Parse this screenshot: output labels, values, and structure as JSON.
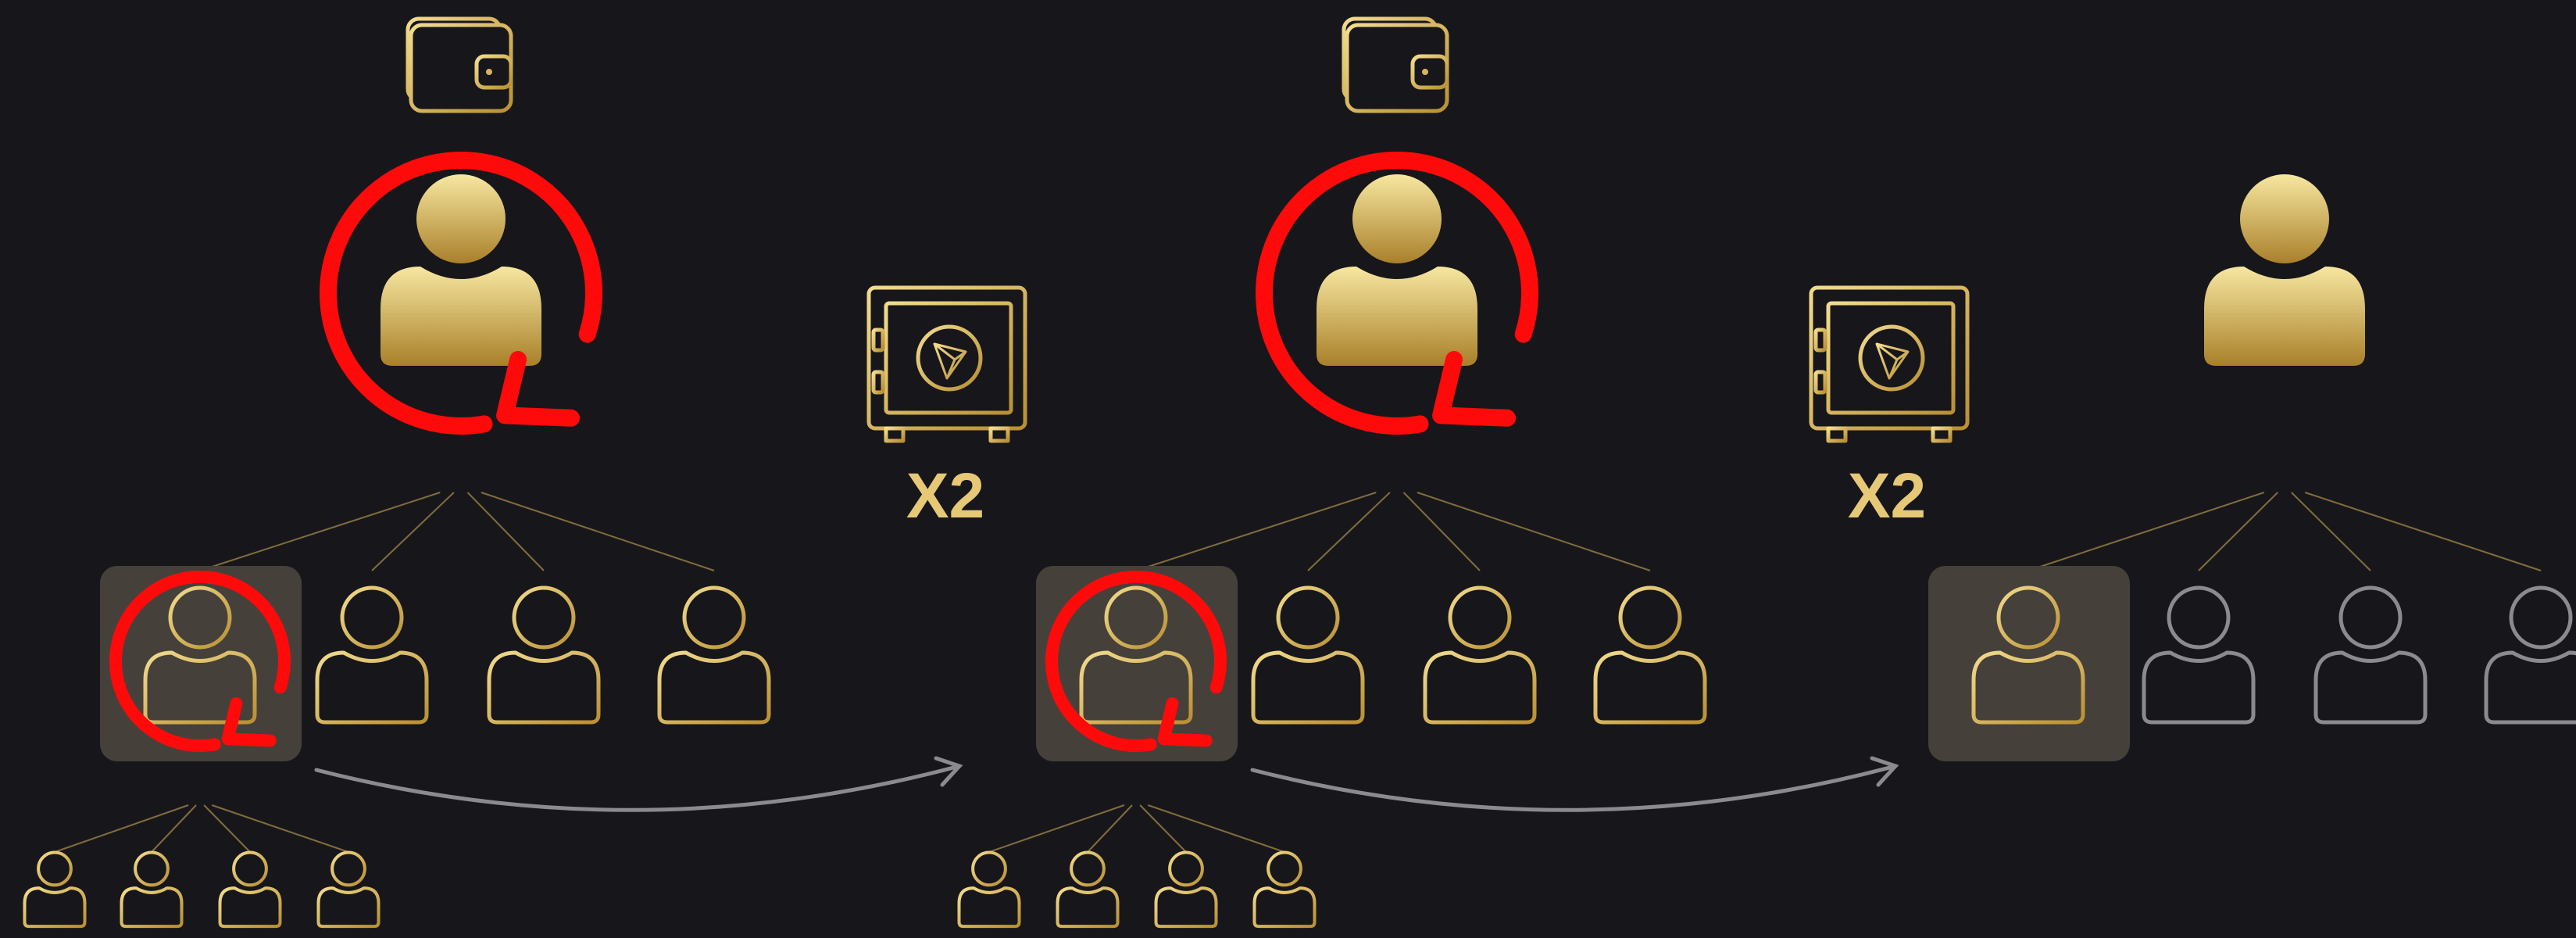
{
  "colors": {
    "background": "#17171b",
    "gold": "#d9b45a",
    "gold_light": "#f7e7a1",
    "gold_dark": "#a9802a",
    "inactive_gray": "#8a8a8f",
    "highlight_box": "#46403a",
    "recycle_red": "#ff0a0a",
    "arrow_gray": "#8a8a8f"
  },
  "multipliers": [
    {
      "label": "X2"
    },
    {
      "label": "X2"
    }
  ],
  "stages": [
    {
      "wallet": true,
      "recycle": true,
      "children": [
        "gold",
        "gold",
        "gold",
        "gold"
      ],
      "highlight_recycle": true,
      "grandchildren": 4
    },
    {
      "wallet": true,
      "recycle": true,
      "children": [
        "gold",
        "gold",
        "gold",
        "gold"
      ],
      "highlight_recycle": true,
      "grandchildren": 4
    },
    {
      "wallet": false,
      "recycle": false,
      "children": [
        "gold",
        "gray",
        "gray",
        "gray"
      ],
      "highlight_recycle": false,
      "grandchildren": 0
    }
  ],
  "icons": [
    "wallet-icon",
    "safe-icon",
    "user-icon",
    "recycle-arrow-icon",
    "curved-arrow-icon"
  ]
}
